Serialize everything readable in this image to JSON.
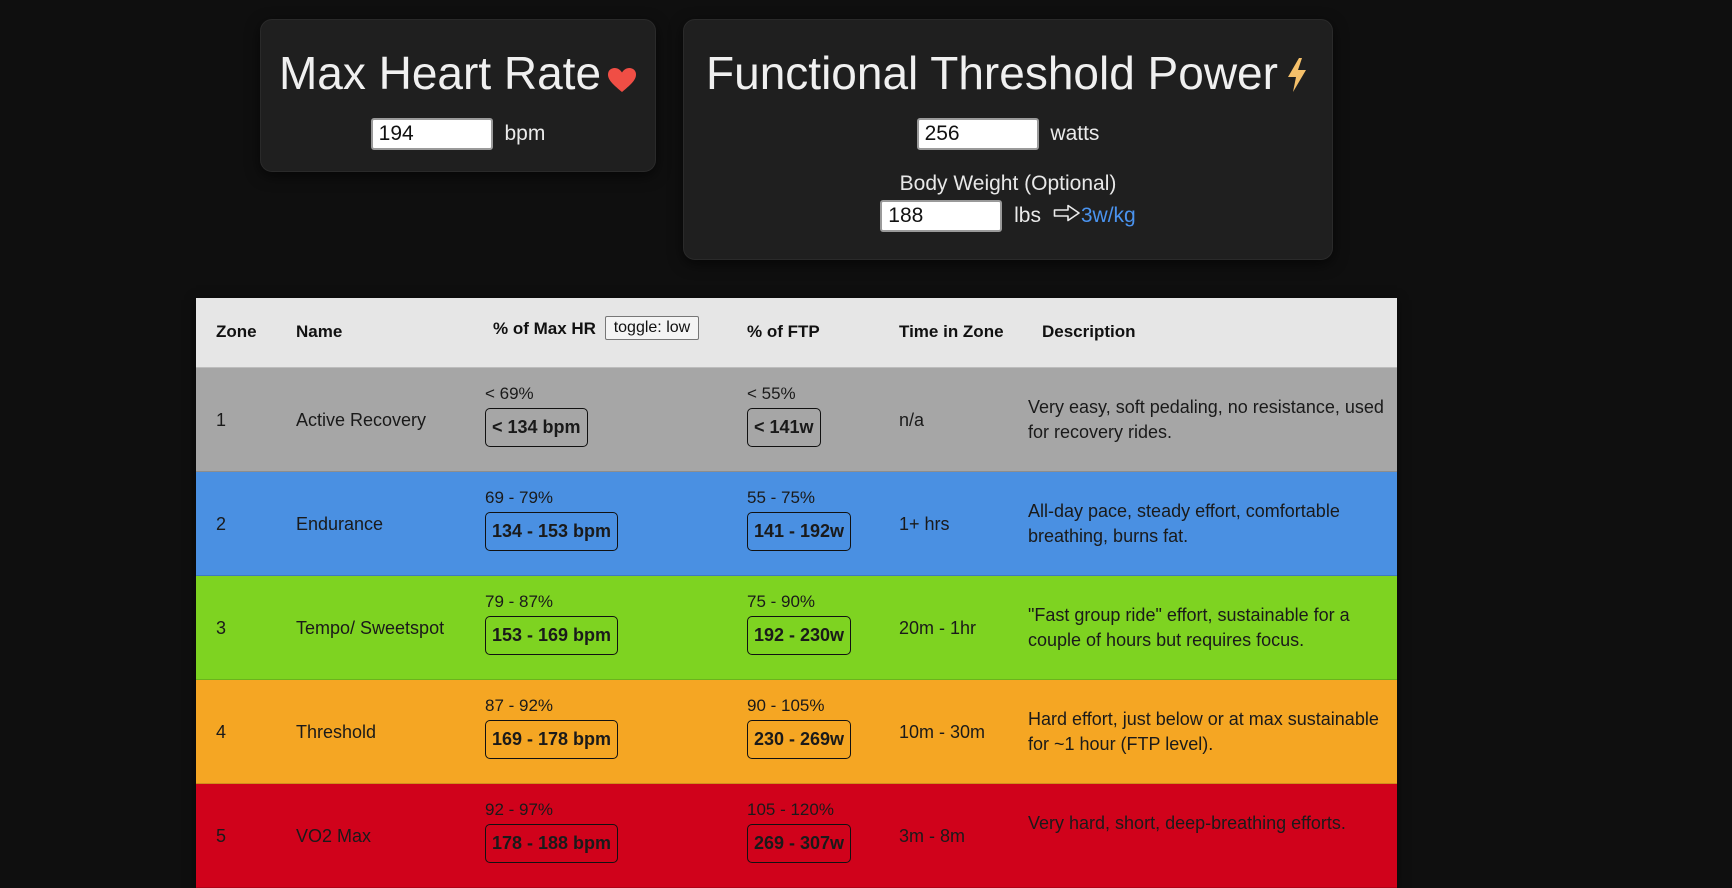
{
  "hr_card": {
    "title": "Max Heart Rate",
    "icon": "heart-icon",
    "icon_color": "#f04e45",
    "value": "194",
    "unit": "bpm"
  },
  "ftp_card": {
    "title": "Functional Threshold Power",
    "icon": "lightning-icon",
    "icon_color": "#f5c06a",
    "value": "256",
    "unit": "watts",
    "weight_label": "Body Weight (Optional)",
    "weight_value": "188",
    "weight_unit": "lbs",
    "wkg": "3w/kg"
  },
  "table": {
    "headers": {
      "zone": "Zone",
      "name": "Name",
      "pct_hr": "% of Max HR",
      "toggle": "toggle: low",
      "pct_ftp": "% of FTP",
      "time": "Time in Zone",
      "description": "Description"
    },
    "rows": [
      {
        "zone": "1",
        "name": "Active Recovery",
        "hr_pct": "< 69%",
        "hr_bpm": "< 134 bpm",
        "ftp_pct": "< 55%",
        "ftp_w": "< 141w",
        "time": "n/a",
        "desc": "Very easy, soft pedaling, no resistance, used for recovery rides.",
        "color": "#a6a6a6"
      },
      {
        "zone": "2",
        "name": "Endurance",
        "hr_pct": "69 - 79%",
        "hr_bpm": "134 - 153 bpm",
        "ftp_pct": "55 - 75%",
        "ftp_w": "141 - 192w",
        "time": "1+ hrs",
        "desc": "All-day pace, steady effort, comfortable breathing, burns fat.",
        "color": "#4a90e2"
      },
      {
        "zone": "3",
        "name": "Tempo/ Sweetspot",
        "hr_pct": "79 - 87%",
        "hr_bpm": "153 - 169 bpm",
        "ftp_pct": "75 - 90%",
        "ftp_w": "192 - 230w",
        "time": "20m - 1hr",
        "desc": "\"Fast group ride\" effort, sustainable for a couple of hours but requires focus.",
        "color": "#7ed321"
      },
      {
        "zone": "4",
        "name": "Threshold",
        "hr_pct": "87 - 92%",
        "hr_bpm": "169 - 178 bpm",
        "ftp_pct": "90 - 105%",
        "ftp_w": "230 - 269w",
        "time": "10m - 30m",
        "desc": "Hard effort, just below or at max sustainable for ~1 hour (FTP level).",
        "color": "#f5a623"
      },
      {
        "zone": "5",
        "name": "VO2 Max",
        "hr_pct": "92 - 97%",
        "hr_bpm": "178 - 188 bpm",
        "ftp_pct": "105 - 120%",
        "ftp_w": "269 - 307w",
        "time": "3m - 8m",
        "desc": "Very hard, short, deep-breathing efforts.",
        "color": "#d0021b"
      }
    ]
  }
}
